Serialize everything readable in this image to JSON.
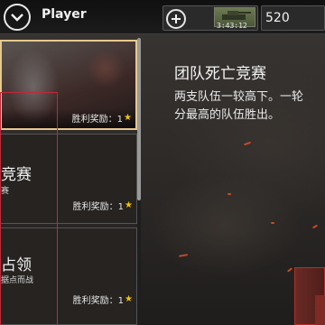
{
  "topbar": {
    "player_name": "Player",
    "timer": "3:43:12",
    "currency": "520"
  },
  "modes": [
    {
      "title": "",
      "subtitle": "",
      "reward_label": "胜利奖励：1",
      "selected": true
    },
    {
      "title": "竞赛",
      "subtitle": "赛",
      "reward_label": "胜利奖励：1",
      "selected": false
    },
    {
      "title": "占领",
      "subtitle": "据点而战",
      "reward_label": "胜利奖励：1",
      "selected": false
    }
  ],
  "detail": {
    "title": "团队死亡竞赛",
    "description": "两支队伍一较高下。一轮\n分最高的队伍胜出。"
  },
  "colors": {
    "accent": "#e6c98e",
    "highlight": "#c0293a",
    "star": "#f2c300"
  },
  "icons": {
    "back": "chevron-down-icon",
    "add": "plus-icon",
    "reward": "star-icon"
  }
}
